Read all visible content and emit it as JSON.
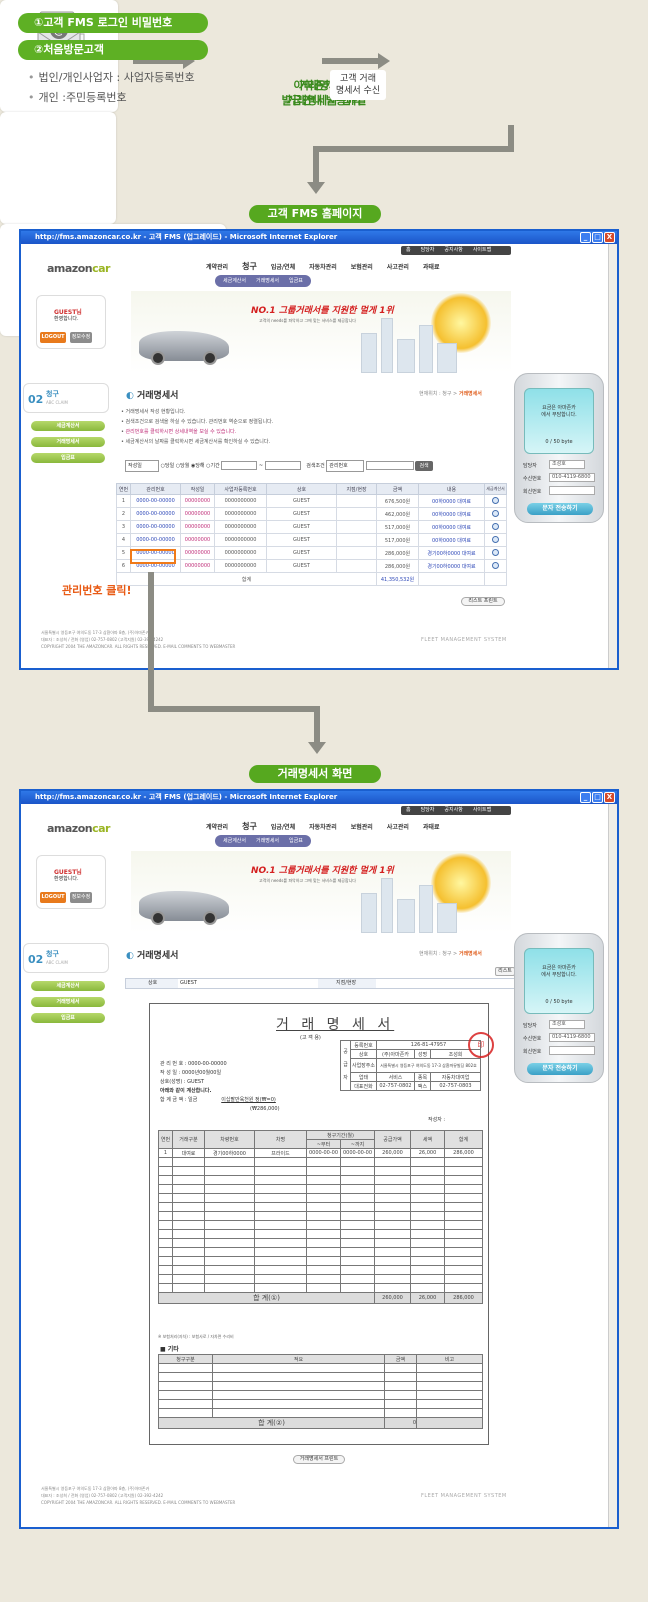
{
  "flow": {
    "step1": {
      "line1": "아마존카에서",
      "line2": "거래명세서 입력",
      "icon": "computer-icon"
    },
    "step2": {
      "line1": "거래명세서",
      "line2": "발급안내 발송메일",
      "icon": "email-icon"
    },
    "arrow_label": {
      "line1": "고객 거래",
      "line2": "명세서 수신"
    },
    "step3": {
      "pill1": "①고객 FMS 로그인 비밀번호",
      "pill2": "②처음방문고객",
      "bullet1": "법인/개인사업자 : 사업자등록번호",
      "bullet2": "개인 :주민등록번호"
    }
  },
  "section1_label": "고객 FMS 홈페이지",
  "section2_label": "거래명세서 화면",
  "browser": {
    "title": "http://fms.amazoncar.co.kr - 고객 FMS (업그레이드) - Microsoft Internet Explorer",
    "btn_min": "_",
    "btn_max": "□",
    "btn_close": "X"
  },
  "site": {
    "logo_a": "amazon",
    "logo_b": "car",
    "topnav": [
      "홈",
      "담당자",
      "공지사항",
      "사이트맵"
    ],
    "menu": [
      "계약관리",
      "청구",
      "입금/연체",
      "자동차관리",
      "보험관리",
      "사고관리",
      "과태료"
    ],
    "submenu": [
      "세금계산서",
      "거래명세서",
      "입금표"
    ],
    "slogan": "NO.1 그룹거래서를 지원한 멀게 1위",
    "banner_sub": "고객의 needs를 파악하고 그에 맞는 서비스를 제공합니다",
    "login_guest": "GUEST님",
    "login_welcome": "환영합니다.",
    "logout": "LOGOUT",
    "info": "정보수정",
    "side_title": "청구",
    "side_num": "02",
    "side_sub": "ABC CLAIM",
    "side_items": [
      "세금계산서",
      "거래명세서",
      "입금표"
    ],
    "page_title": "거래명세서",
    "breadcrumb_prefix": "현재위치 : 청구 > ",
    "breadcrumb_current": "거래명세서",
    "notes": [
      "거래명세서 작성 현황입니다.",
      "검색조건으로 검색을 하실 수 있습니다. 관리번호 역순으로 정렬됩니다.",
      "관리번호를 클릭하시면 상세내역을 보실 수 있습니다.",
      "세금계산서의 날짜를 클릭하시면 세금계산서를 확인하실 수 있습니다."
    ],
    "filter": {
      "select1": "작성일",
      "radio1": "당일",
      "radio2": "당월",
      "radio3": "당해",
      "radio4": "기간",
      "tilde": "~",
      "cond_label": "검색조건",
      "select2": "관리번호",
      "search": "검색"
    },
    "table_headers": [
      "연번",
      "관리번호",
      "작성일",
      "사업자등록번호",
      "상호",
      "지점/현장",
      "금액",
      "내용",
      "세금계산서"
    ],
    "rows": [
      [
        "1",
        "0000-00-00000",
        "00000000",
        "0000000000",
        "GUEST",
        "",
        "676,500원",
        "00하0000 대여료"
      ],
      [
        "2",
        "0000-00-00000",
        "00000000",
        "0000000000",
        "GUEST",
        "",
        "462,000원",
        "00하0000 대여료"
      ],
      [
        "3",
        "0000-00-00000",
        "00000000",
        "0000000000",
        "GUEST",
        "",
        "517,000원",
        "00하0000 대여료"
      ],
      [
        "4",
        "0000-00-00000",
        "00000000",
        "0000000000",
        "GUEST",
        "",
        "517,000원",
        "00하0000 대여료"
      ],
      [
        "5",
        "0000-00-00000",
        "00000000",
        "0000000000",
        "GUEST",
        "",
        "286,000원",
        "경기00하0000 대여료"
      ],
      [
        "6",
        "0000-00-00000",
        "00000000",
        "0000000000",
        "GUEST",
        "",
        "286,000원",
        "경기00하0000 대여료"
      ]
    ],
    "total_label": "합계",
    "total_amount": "41,350,532원",
    "list_print": "리스트 프린트",
    "click_note": "관리번호 클릭!",
    "footer1": "서울특별시 영등포구 여의도동 17-3 삼환아파 8층, (주)아마존카",
    "footer2": "대표자 : 조성희 / 전화 (영업) 02-757-0802 (고객지원) 02-392-4242",
    "footer3": "COPYRIGHT 2004 THE AMAZONCAR. ALL RIGHTS RESERVED. E-MAIL COMMENTS TO WEBMASTER",
    "fms": "FLEET MANAGEMENT SYSTEM"
  },
  "phone": {
    "msg1": "요금은 아마존카",
    "msg2": "에서 부담합니다.",
    "counter": "0  / 50 byte",
    "lbl_manager": "담당자",
    "val_manager": "조성호",
    "lbl_recv": "수신번호",
    "val_recv": "010-4119-6800",
    "lbl_reply": "회신번호",
    "send": "문자 전송하기"
  },
  "detail": {
    "list_btn": "리스트",
    "bar_label1": "상호",
    "bar_value1": "GUEST",
    "bar_label2": "지점/현장",
    "doc_title": "거 래 명 세 서",
    "doc_sub": "(고 객 용)",
    "mgmt": "관 리 번 호 :   0000-00-00000",
    "date": "작  성  일  :   0000년00월00일",
    "company": "상호(성명) :   GUEST",
    "phrase": "아래와 같이 계산합니다.",
    "total_label": "합 계 금 액  :  일금",
    "total_words": "이십팔만육천원 정(₩=0)",
    "total_num": "(₩286,000)",
    "supplier_reg_label": "등록번호",
    "supplier_reg": "126-81-47957",
    "supplier_side": [
      "공",
      "급",
      "자"
    ],
    "sup_name_label": "상호",
    "sup_name": "(주)아마존카",
    "sup_rep_label": "성명",
    "sup_rep": "조성희",
    "sup_addr_label": "사업장주소",
    "sup_addr": "서울특별시 영등포구 여의도동 17-3 삼환까뮤빌딩 802호",
    "sup_type_label": "업태",
    "sup_type": "서비스",
    "sup_item_label": "종목",
    "sup_item": "자동차대여업",
    "sup_tel_label": "대표전화",
    "sup_tel": "02-757-0802",
    "sup_fax_label": "팩스",
    "sup_fax": "02-757-0803",
    "stamp": "印",
    "writer": "작성자 :",
    "item_headers": [
      "연번",
      "거래구분",
      "차량번호",
      "차명",
      "청구기간(월)",
      "공급가액",
      "세액",
      "합계"
    ],
    "period_from": "~부터",
    "period_to": "~까지",
    "item_row": [
      "1",
      "대여료",
      "경기00하0000",
      "프라이드",
      "0000-00-00",
      "0000-00-00",
      "260,000",
      "26,000",
      "286,000"
    ],
    "sum1_label": "합 계(①)",
    "sum1": [
      "260,000",
      "26,000",
      "286,000"
    ],
    "note_small": "※ 보험처리(자차) : 보험사로 / 자차면 수리비",
    "etc_title": "■ 기타",
    "etc_headers": [
      "청구구분",
      "적요",
      "금액",
      "비고"
    ],
    "sum2_label": "합 계(②)",
    "sum2": "0",
    "print_btn": "거래명세서 프린트"
  }
}
